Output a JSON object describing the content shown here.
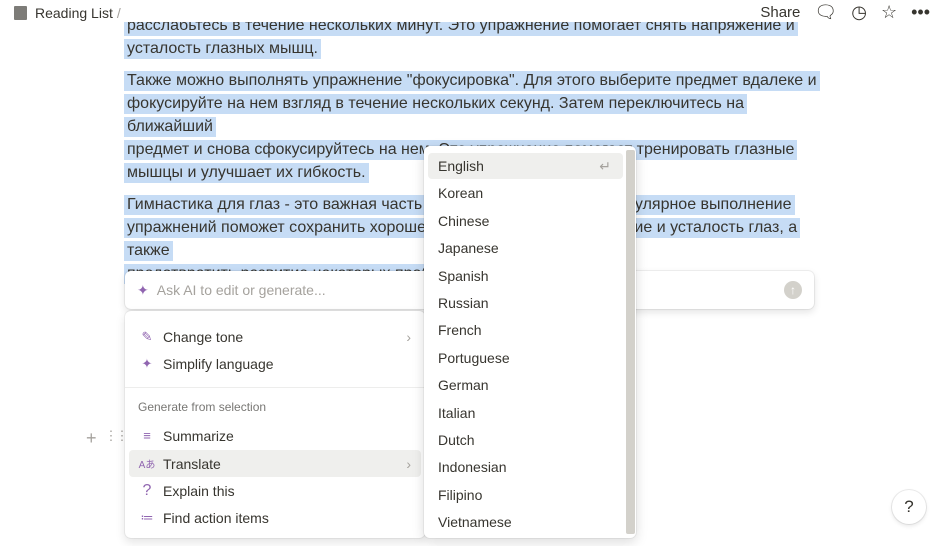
{
  "breadcrumb": {
    "title": "Reading List",
    "separator": "/"
  },
  "header": {
    "share": "Share"
  },
  "paragraphs": [
    [
      "расслабьтесь в течение нескольких минут. Это упражнение помогает снять напряжение и",
      "усталость глазных мышц."
    ],
    [
      "Также можно выполнять упражнение \"фокусировка\". Для этого выберите предмет вдалеке и",
      "фокусируйте на нем взгляд в течение нескольких секунд. Затем переключитесь на ближайший",
      "предмет и снова сфокусируйтесь на нем. Это упражнение помогает тренировать глазные",
      "мышцы и улучшает их гибкость."
    ],
    [
      "Гимнастика для глаз - это важная часть заботы о здоровье глаз. Регулярное выполнение",
      "упражнений поможет сохранить хорошее зрение, снизить напряжение и усталость глаз, а также",
      "предотвратить развитие некоторых проблем со зрением."
    ]
  ],
  "ai": {
    "placeholder": "Ask AI to edit or generate..."
  },
  "menu": {
    "items": [
      {
        "label": "Change tone",
        "icon": "mic-icon"
      },
      {
        "label": "Simplify language",
        "icon": "sparkle-icon"
      }
    ],
    "section": "Generate from selection",
    "gen": [
      {
        "label": "Summarize",
        "icon": "summarize-icon"
      },
      {
        "label": "Translate",
        "icon": "translate-icon"
      },
      {
        "label": "Explain this",
        "icon": "question-icon"
      },
      {
        "label": "Find action items",
        "icon": "checklist-icon"
      }
    ]
  },
  "languages": [
    "English",
    "Korean",
    "Chinese",
    "Japanese",
    "Spanish",
    "Russian",
    "French",
    "Portuguese",
    "German",
    "Italian",
    "Dutch",
    "Indonesian",
    "Filipino",
    "Vietnamese"
  ],
  "help": "?"
}
